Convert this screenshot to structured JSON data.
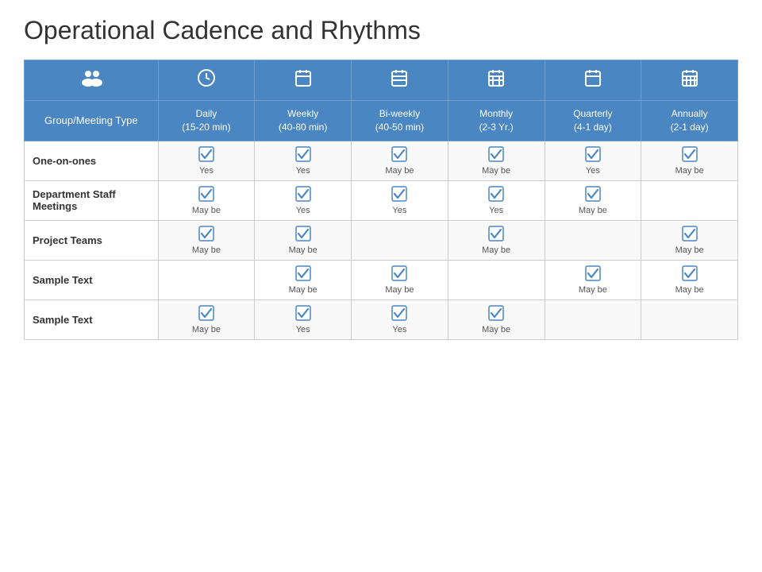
{
  "title": "Operational Cadence and Rhythms",
  "columns": [
    {
      "id": "group",
      "icon": "people",
      "label": "Group/Meeting Type",
      "sublabel": ""
    },
    {
      "id": "daily",
      "icon": "clock",
      "label": "Daily",
      "sublabel": "(15-20 min)"
    },
    {
      "id": "weekly",
      "icon": "calendar-week",
      "label": "Weekly",
      "sublabel": "(40-80 min)"
    },
    {
      "id": "biweekly",
      "icon": "calendar-biweek",
      "label": "Bi-weekly",
      "sublabel": "(40-50 min)"
    },
    {
      "id": "monthly",
      "icon": "calendar-month",
      "label": "Monthly",
      "sublabel": "(2-3 Yr.)"
    },
    {
      "id": "quarterly",
      "icon": "calendar-quarter",
      "label": "Quarterly",
      "sublabel": "(4-1 day)"
    },
    {
      "id": "annually",
      "icon": "calendar-annual",
      "label": "Annually",
      "sublabel": "(2-1 day)"
    }
  ],
  "rows": [
    {
      "group": "One-on-ones",
      "daily": {
        "check": true,
        "label": "Yes"
      },
      "weekly": {
        "check": true,
        "label": "Yes"
      },
      "biweekly": {
        "check": true,
        "label": "May be"
      },
      "monthly": {
        "check": true,
        "label": "May be"
      },
      "quarterly": {
        "check": true,
        "label": "Yes"
      },
      "annually": {
        "check": true,
        "label": "May be"
      }
    },
    {
      "group": "Department Staff Meetings",
      "daily": {
        "check": true,
        "label": "May be"
      },
      "weekly": {
        "check": true,
        "label": "Yes"
      },
      "biweekly": {
        "check": true,
        "label": "Yes"
      },
      "monthly": {
        "check": true,
        "label": "Yes"
      },
      "quarterly": {
        "check": true,
        "label": "May be"
      },
      "annually": {
        "check": false,
        "label": ""
      }
    },
    {
      "group": "Project Teams",
      "daily": {
        "check": true,
        "label": "May be"
      },
      "weekly": {
        "check": true,
        "label": "May be"
      },
      "biweekly": {
        "check": false,
        "label": ""
      },
      "monthly": {
        "check": true,
        "label": "May be"
      },
      "quarterly": {
        "check": false,
        "label": ""
      },
      "annually": {
        "check": true,
        "label": "May be"
      }
    },
    {
      "group": "Sample Text",
      "daily": {
        "check": false,
        "label": ""
      },
      "weekly": {
        "check": true,
        "label": "May be"
      },
      "biweekly": {
        "check": true,
        "label": "May be"
      },
      "monthly": {
        "check": false,
        "label": ""
      },
      "quarterly": {
        "check": true,
        "label": "May be"
      },
      "annually": {
        "check": true,
        "label": "May be"
      }
    },
    {
      "group": "Sample Text",
      "daily": {
        "check": true,
        "label": "May be"
      },
      "weekly": {
        "check": true,
        "label": "Yes"
      },
      "biweekly": {
        "check": true,
        "label": "Yes"
      },
      "monthly": {
        "check": true,
        "label": "May be"
      },
      "quarterly": {
        "check": false,
        "label": ""
      },
      "annually": {
        "check": false,
        "label": ""
      }
    }
  ],
  "icons": {
    "people": "&#128101;",
    "clock": "&#128336;",
    "calendar-week": "&#128197;",
    "calendar-biweek": "&#128198;",
    "calendar-month": "&#128467;",
    "calendar-quarter": "&#128203;",
    "calendar-annual": "&#128201;"
  }
}
